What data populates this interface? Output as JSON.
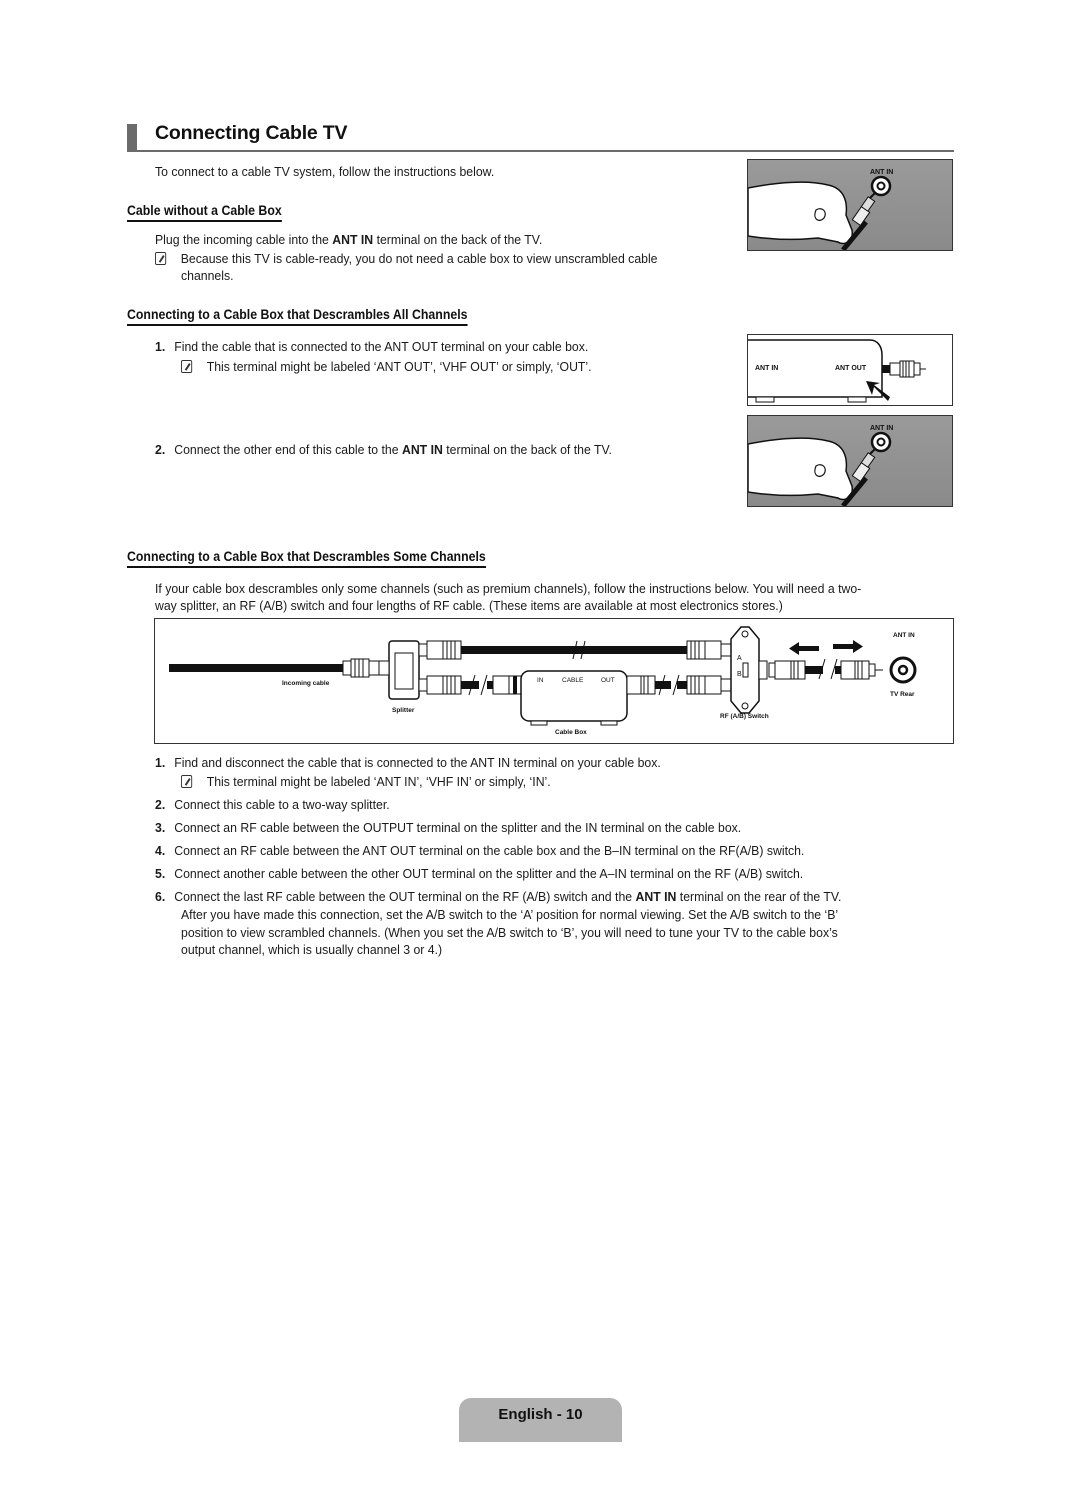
{
  "page": {
    "title": "Connecting Cable TV",
    "intro": "To connect to a cable TV system, follow the instructions below.",
    "footer": "English - 10"
  },
  "section1": {
    "heading": "Cable without a Cable Box",
    "text_pre": "Plug the incoming cable into the ",
    "text_bold": "ANT IN",
    "text_post": " terminal on the back of the TV.",
    "note_line1": "Because this TV is cable-ready, you do not need a cable box to view unscrambled cable",
    "note_line2": "channels.",
    "figure": {
      "label": "ANT IN",
      "icon": "hand-plugging-cable"
    }
  },
  "section2": {
    "heading": "Connecting to a Cable Box that Descrambles All Channels",
    "steps": [
      {
        "num": "1.",
        "text": "Find the cable that is connected to the ANT OUT terminal on your cable box.",
        "note": "This terminal might be labeled ‘ANT OUT’, ‘VHF OUT’ or simply, ‘OUT’."
      },
      {
        "num": "2.",
        "text_pre": "Connect the other end of this cable to the ",
        "text_bold": "ANT IN",
        "text_post": " terminal on the back of the TV."
      }
    ],
    "figure_box": {
      "label_in": "ANT IN",
      "label_out": "ANT OUT",
      "icon": "arrow-pointer"
    },
    "figure_tv": {
      "label": "ANT IN",
      "icon": "hand-plugging-cable"
    }
  },
  "section3": {
    "heading": "Connecting to a Cable Box that Descrambles Some Channels",
    "intro_line1": "If your cable box descrambles only some channels (such as premium channels), follow the instructions below. You will need a two-",
    "intro_line2": "way splitter, an RF (A/B) switch and four lengths of RF cable. (These items are available at most electronics stores.)",
    "diagram": {
      "incoming_cable": "Incoming cable",
      "splitter": "Splitter",
      "cable_box": "Cable Box",
      "box_in": "IN",
      "box_cable": "CABLE",
      "box_out": "OUT",
      "switch": "RF (A/B) Switch",
      "switch_a": "A",
      "switch_b": "B",
      "ant_in": "ANT IN",
      "tv_rear": "TV Rear"
    },
    "steps": [
      {
        "num": "1.",
        "text": "Find and disconnect the cable that is connected to the ANT IN terminal on your cable box.",
        "note": "This terminal might be labeled ‘ANT IN’, ‘VHF IN’ or simply, ‘IN’."
      },
      {
        "num": "2.",
        "text": "Connect this cable to a two-way splitter."
      },
      {
        "num": "3.",
        "text": "Connect an RF cable between the OUTPUT terminal on the splitter and the IN terminal on the cable box."
      },
      {
        "num": "4.",
        "text": "Connect an RF cable between the ANT OUT terminal on the cable box and the B–IN terminal on the RF(A/B) switch."
      },
      {
        "num": "5.",
        "text": "Connect another cable between the other OUT terminal on the splitter and the A–IN terminal on the RF (A/B) switch."
      },
      {
        "num": "6.",
        "text_pre": "Connect the last RF cable between the OUT terminal on the RF (A/B) switch and the ",
        "text_bold": "ANT IN",
        "text_post": " terminal on the rear of the TV.",
        "cont1": "After you have made this connection, set the A/B switch to the ‘A’ position for normal viewing. Set the A/B switch to the ‘B’",
        "cont2": "position to view scrambled channels. (When you set the A/B switch to ‘B’, you will need to tune your TV to the cable box’s",
        "cont3": "output channel, which is usually channel 3 or 4.)"
      }
    ]
  }
}
